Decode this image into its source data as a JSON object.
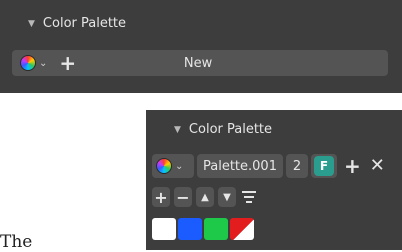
{
  "top_panel": {
    "header_label": "Color Palette",
    "new_label": "New"
  },
  "bottom_panel": {
    "header_label": "Color Palette",
    "palette_name": "Palette.001",
    "user_count": "2",
    "fake_user_glyph": "F",
    "swatches": [
      {
        "color": "#ffffff"
      },
      {
        "color": "#1a5cff"
      },
      {
        "color": "#1ec94a"
      },
      {
        "color_a": "#e31d1d",
        "color_b": "#ffffff"
      }
    ]
  },
  "background_text": "The"
}
